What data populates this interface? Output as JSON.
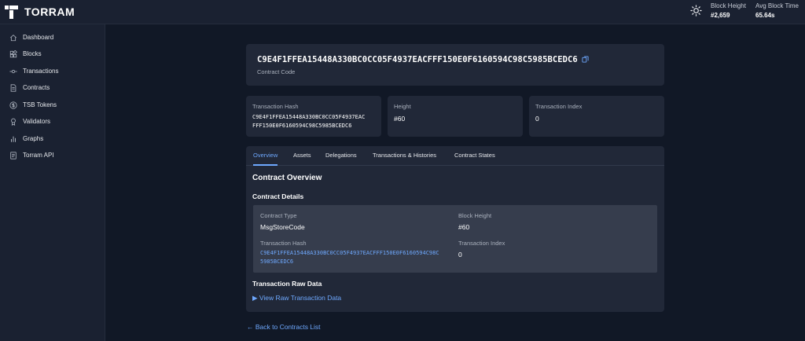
{
  "brand": {
    "name": "TORRAM"
  },
  "header": {
    "theme_icon": "sun-icon",
    "stats": [
      {
        "label": "Block Height",
        "value": "#2,659"
      },
      {
        "label": "Avg Block Time",
        "value": "65.64s"
      }
    ]
  },
  "sidebar": {
    "items": [
      {
        "label": "Dashboard",
        "icon": "home-icon"
      },
      {
        "label": "Blocks",
        "icon": "blocks-icon"
      },
      {
        "label": "Transactions",
        "icon": "transactions-icon"
      },
      {
        "label": "Contracts",
        "icon": "document-icon"
      },
      {
        "label": "TSB Tokens",
        "icon": "dollar-coin-icon"
      },
      {
        "label": "Validators",
        "icon": "validator-icon"
      },
      {
        "label": "Graphs",
        "icon": "bar-chart-icon"
      },
      {
        "label": "Torram API",
        "icon": "api-doc-icon"
      }
    ]
  },
  "contract": {
    "code": "C9E4F1FFEA15448A330BC0CC05F4937EACFFF150E0F6160594C98C5985BCEDC6",
    "subtitle": "Contract Code"
  },
  "info_cards": {
    "hash": {
      "label": "Transaction Hash",
      "line1": "C9E4F1FFEA15448A330BC0CC05F4937EAC",
      "line2": "FFF150E0F6160594C98C5985BCEDC6"
    },
    "height": {
      "label": "Height",
      "value": "#60"
    },
    "index": {
      "label": "Transaction Index",
      "value": "0"
    }
  },
  "tabs": [
    {
      "label": "Overview",
      "active": true
    },
    {
      "label": "Assets",
      "active": false
    },
    {
      "label": "Delegations",
      "active": false
    },
    {
      "label": "Transactions & Histories",
      "active": false
    },
    {
      "label": "Contract States",
      "active": false
    }
  ],
  "overview": {
    "title": "Contract Overview",
    "details_title": "Contract Details",
    "contract_type_label": "Contract Type",
    "contract_type": "MsgStoreCode",
    "block_height_label": "Block Height",
    "block_height": "#60",
    "tx_hash_label": "Transaction Hash",
    "tx_hash_line1": "C9E4F1FFEA15448A330BC0CC05F4937EACFFF150E0F6160594C98C",
    "tx_hash_line2": "5985BCEDC6",
    "tx_index_label": "Transaction Index",
    "tx_index": "0",
    "raw_title": "Transaction Raw Data",
    "raw_link": "▶ View Raw Transaction Data"
  },
  "footer": {
    "back_link": "← Back to Contracts List"
  },
  "colors": {
    "background": "#111826",
    "panel": "#212838",
    "sidebar": "#1a2131",
    "details_box": "#363d4d",
    "accent": "#6ea8fe"
  }
}
